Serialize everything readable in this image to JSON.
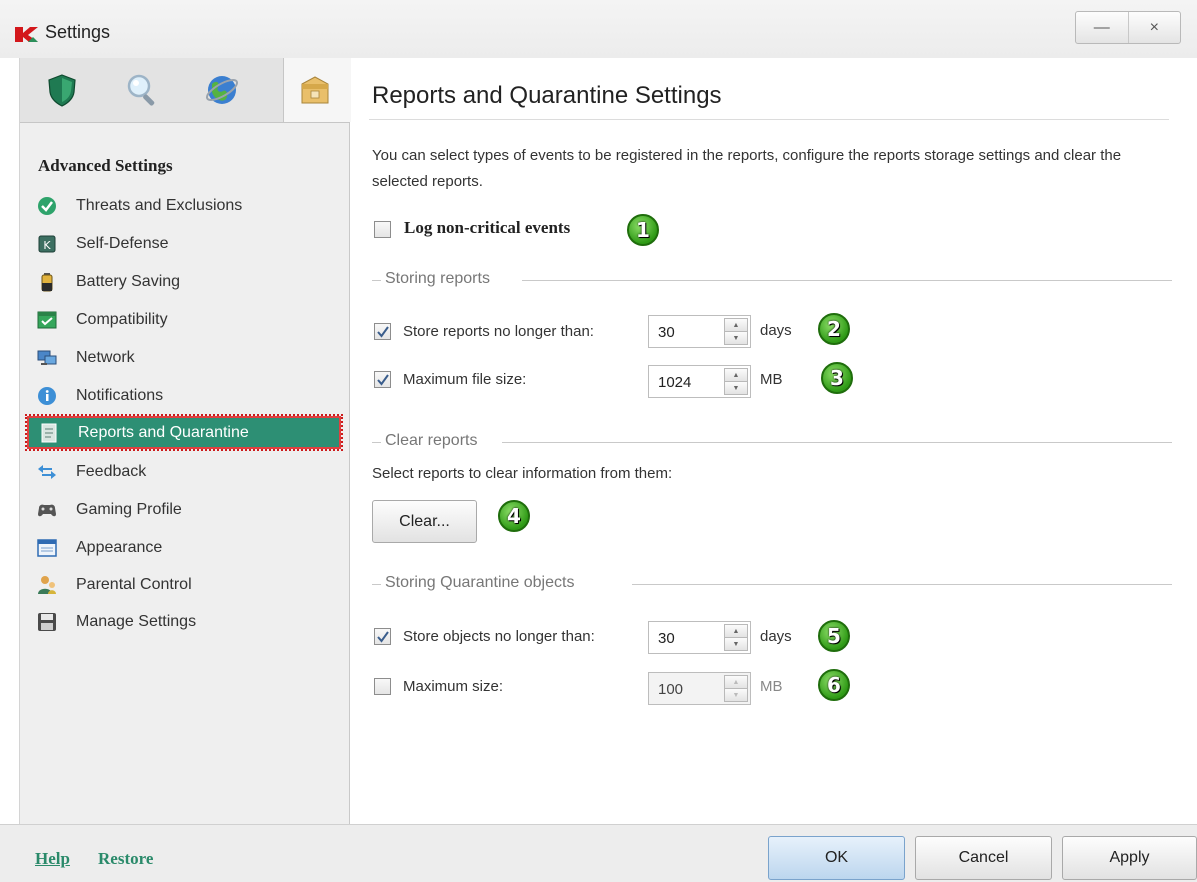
{
  "window": {
    "title": "Settings",
    "minimize_label": "—",
    "close_label": "×"
  },
  "sidebar": {
    "tabs": [
      {
        "name": "protection-tab",
        "icon": "shield-icon"
      },
      {
        "name": "scan-tab",
        "icon": "magnifier-icon"
      },
      {
        "name": "update-tab",
        "icon": "globe-icon"
      },
      {
        "name": "advanced-tab",
        "icon": "box-icon",
        "selected": true
      }
    ],
    "section_title": "Advanced Settings",
    "items": [
      {
        "label": "Threats and Exclusions",
        "icon": "checkmark-circle-icon"
      },
      {
        "label": "Self-Defense",
        "icon": "k-shield-icon"
      },
      {
        "label": "Battery Saving",
        "icon": "battery-icon"
      },
      {
        "label": "Compatibility",
        "icon": "compatibility-icon"
      },
      {
        "label": "Network",
        "icon": "network-icon"
      },
      {
        "label": "Notifications",
        "icon": "info-icon"
      },
      {
        "label": "Reports and Quarantine",
        "icon": "report-icon",
        "active": true
      },
      {
        "label": "Feedback",
        "icon": "arrows-icon"
      },
      {
        "label": "Gaming Profile",
        "icon": "gamepad-icon"
      },
      {
        "label": "Appearance",
        "icon": "window-icon"
      },
      {
        "label": "Parental Control",
        "icon": "parent-icon"
      },
      {
        "label": "Manage Settings",
        "icon": "floppy-icon"
      }
    ]
  },
  "main": {
    "title": "Reports and Quarantine Settings",
    "description": "You can select types of events to be registered in the reports, configure the reports storage settings and clear the selected reports.",
    "log_noncritical": {
      "label": "Log non-critical events",
      "checked": false,
      "badge": "1"
    },
    "storing_reports": {
      "heading": "Storing reports",
      "store_days": {
        "label": "Store reports no longer than:",
        "checked": true,
        "value": "30",
        "unit": "days",
        "badge": "2"
      },
      "max_file_size": {
        "label": "Maximum file size:",
        "checked": true,
        "value": "1024",
        "unit": "MB",
        "badge": "3"
      }
    },
    "clear_reports": {
      "heading": "Clear reports",
      "instruction": "Select reports to clear information from them:",
      "button_label": "Clear...",
      "badge": "4"
    },
    "storing_quarantine": {
      "heading": "Storing Quarantine objects",
      "store_days": {
        "label": "Store objects no longer than:",
        "checked": true,
        "value": "30",
        "unit": "days",
        "badge": "5"
      },
      "max_size": {
        "label": "Maximum size:",
        "checked": false,
        "value": "100",
        "unit": "MB",
        "badge": "6"
      }
    }
  },
  "footer": {
    "help_label": "Help",
    "restore_label": "Restore",
    "ok_label": "OK",
    "cancel_label": "Cancel",
    "apply_label": "Apply"
  },
  "colors": {
    "accent": "#2d8f74",
    "badge_green": "#2f9a16",
    "highlight_border": "#cc1b1b"
  }
}
